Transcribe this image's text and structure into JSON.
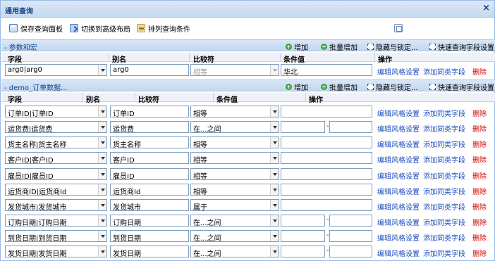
{
  "window": {
    "title": "通用查询",
    "close": "×"
  },
  "toolbar": {
    "save_label": "保存查询面板",
    "switch_label": "切换到高级布局",
    "sort_label": "排列查询条件"
  },
  "section_buttons": {
    "add": "增加",
    "batch_add": "批量增加",
    "hide_lock": "隐藏与锁定...",
    "quick_settings": "快速查询字段设置"
  },
  "params_section": {
    "title": "- 参数和宏",
    "headers": {
      "field": "字段",
      "alias": "别名",
      "op": "比较符",
      "value": "条件值",
      "action": "操作"
    },
    "row": {
      "field": "arg0|arg0",
      "alias": "arg0",
      "op": "相等",
      "value": "华北"
    }
  },
  "demo_section": {
    "title": "- demo_订单数据...",
    "headers": {
      "field": "字段",
      "alias": "别名",
      "op": "比较符",
      "value": "条件值",
      "action": "操作"
    },
    "rows": [
      {
        "field": "订单ID|订单ID",
        "alias": "订单ID",
        "op": "相等",
        "range": false
      },
      {
        "field": "运货费|运货费",
        "alias": "运货费",
        "op": "在...之间",
        "range": true
      },
      {
        "field": "货主名称|货主名称",
        "alias": "货主名称",
        "op": "相等",
        "range": false
      },
      {
        "field": "客户ID|客户ID",
        "alias": "客户ID",
        "op": "相等",
        "range": false
      },
      {
        "field": "雇员ID|雇员ID",
        "alias": "雇员ID",
        "op": "相等",
        "range": false
      },
      {
        "field": "运货商ID|运货商Id",
        "alias": "运货商Id",
        "op": "相等",
        "range": false
      },
      {
        "field": "发货城市|发货城市",
        "alias": "发货城市",
        "op": "属于",
        "range": false
      },
      {
        "field": "订购日期|订购日期",
        "alias": "订购日期",
        "op": "在...之间",
        "range": true
      },
      {
        "field": "到货日期|到货日期",
        "alias": "到货日期",
        "op": "在...之间",
        "range": true
      },
      {
        "field": "发货日期|发货日期",
        "alias": "发货日期",
        "op": "在...之间",
        "range": true
      }
    ]
  },
  "row_actions": {
    "edit_style": "编辑风格设置",
    "add_same": "添加同类字段",
    "delete": "删除"
  },
  "range_separator": "-"
}
